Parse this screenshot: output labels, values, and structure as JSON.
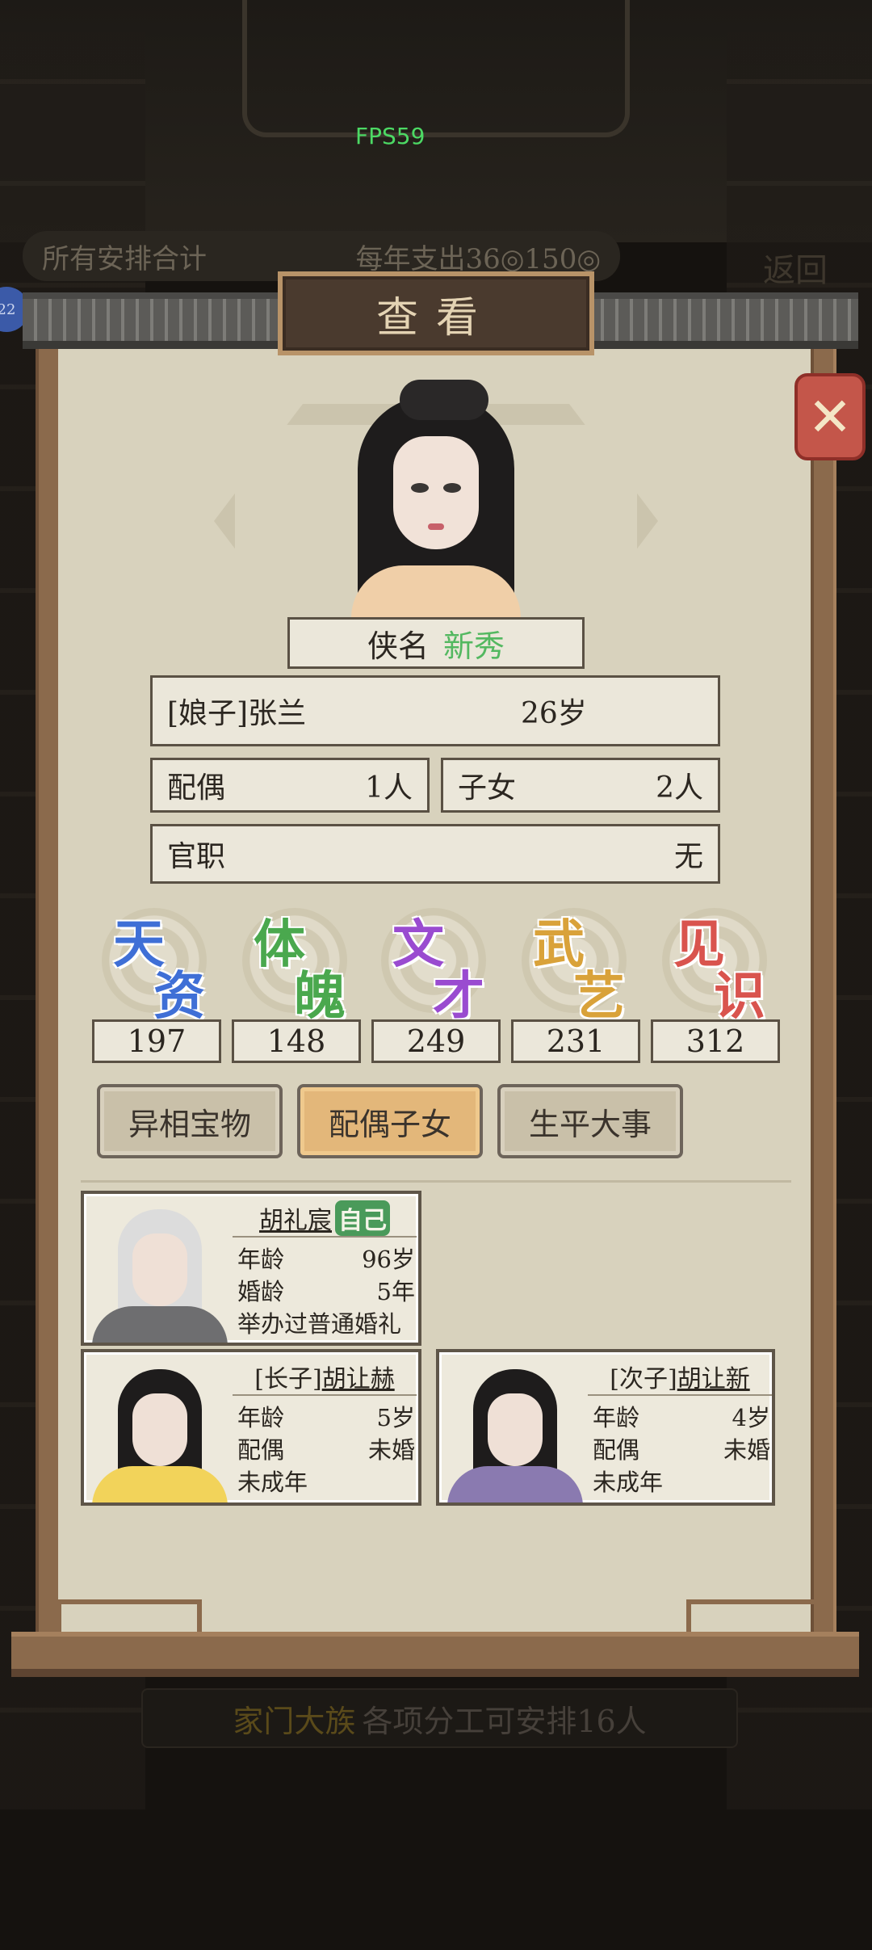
{
  "hud": {
    "fps": "FPS59",
    "summary_label": "所有安排合计",
    "summary_right": "每年支出36◎150◎",
    "return_label": "返回",
    "left_badge": "22",
    "bottom_hint_prefix": "家门大族",
    "bottom_hint": "各项分工可安排16人"
  },
  "dialog": {
    "title": "查看",
    "close_icon": "close-icon"
  },
  "character": {
    "nickname_label": "侠名",
    "nickname": "新秀",
    "name": "[娘子]张兰",
    "age": "26岁",
    "spouse_label": "配偶",
    "spouse_value": "1人",
    "children_label": "子女",
    "children_value": "2人",
    "post_label": "官职",
    "post_value": "无"
  },
  "stats": [
    {
      "c1": "天",
      "c2": "资",
      "value": "197",
      "color": "#3f6fd6"
    },
    {
      "c1": "体",
      "c2": "魄",
      "value": "148",
      "color": "#4aa84e"
    },
    {
      "c1": "文",
      "c2": "才",
      "value": "249",
      "color": "#9a4bd0"
    },
    {
      "c1": "武",
      "c2": "艺",
      "value": "231",
      "color": "#d9a23a"
    },
    {
      "c1": "见",
      "c2": "识",
      "value": "312",
      "color": "#d9544e"
    }
  ],
  "tabs": [
    {
      "label": "异相宝物",
      "active": false
    },
    {
      "label": "配偶子女",
      "active": true
    },
    {
      "label": "生平大事",
      "active": false
    }
  ],
  "members": [
    {
      "name": "胡礼宸",
      "tag": "自己",
      "lines": [
        {
          "label": "年龄",
          "value": "96岁"
        },
        {
          "label": "婚龄",
          "value": "5年"
        },
        {
          "label": "举办过普通婚礼",
          "value": ""
        }
      ]
    },
    {
      "prefix": "[长子]",
      "name": "胡让赫",
      "lines": [
        {
          "label": "年龄",
          "value": "5岁"
        },
        {
          "label": "配偶",
          "value": "未婚"
        },
        {
          "label": "未成年",
          "value": ""
        }
      ]
    },
    {
      "prefix": "[次子]",
      "name": "胡让新",
      "lines": [
        {
          "label": "年龄",
          "value": "4岁"
        },
        {
          "label": "配偶",
          "value": "未婚"
        },
        {
          "label": "未成年",
          "value": ""
        }
      ]
    }
  ]
}
